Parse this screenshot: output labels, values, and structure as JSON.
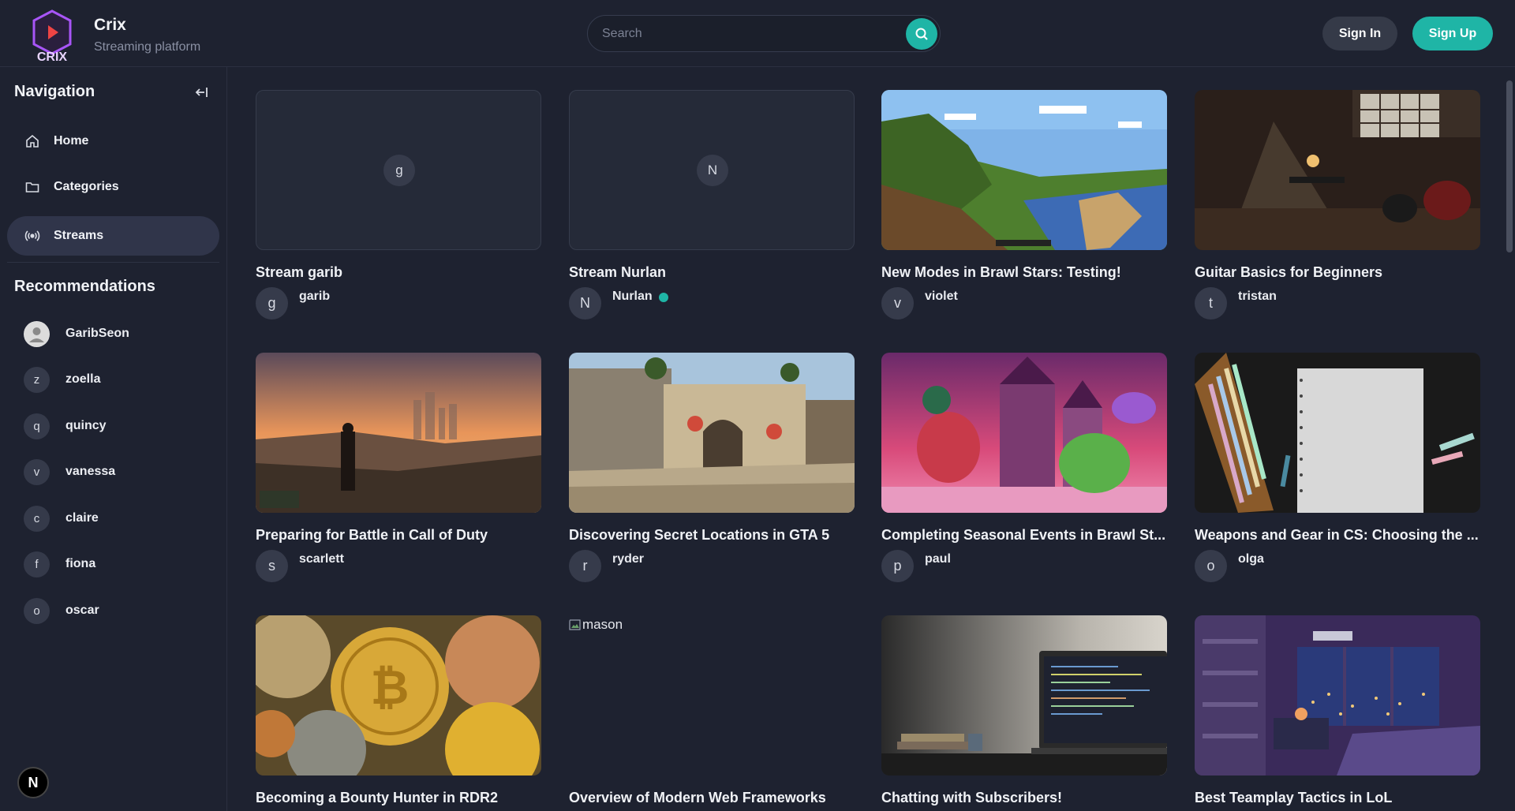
{
  "header": {
    "logo_text": "CRIX",
    "brand_name": "Crix",
    "brand_sub": "Streaming platform",
    "search_placeholder": "Search",
    "signin_label": "Sign In",
    "signup_label": "Sign Up"
  },
  "colors": {
    "accent": "#1fb5a6",
    "background": "#1e2230",
    "logo": "#a855f7"
  },
  "sidebar": {
    "nav_title": "Navigation",
    "nav_items": [
      {
        "label": "Home",
        "icon": "home-icon"
      },
      {
        "label": "Categories",
        "icon": "folder-icon"
      },
      {
        "label": "Streams",
        "icon": "broadcast-icon",
        "active": true
      }
    ],
    "rec_title": "Recommendations",
    "recommendations": [
      {
        "initial": "",
        "name": "GaribSeon"
      },
      {
        "initial": "z",
        "name": "zoella"
      },
      {
        "initial": "q",
        "name": "quincy"
      },
      {
        "initial": "v",
        "name": "vanessa"
      },
      {
        "initial": "c",
        "name": "claire"
      },
      {
        "initial": "f",
        "name": "fiona"
      },
      {
        "initial": "o",
        "name": "oscar"
      }
    ],
    "badge": "N"
  },
  "streams": [
    {
      "title": "Stream garib",
      "user": "garib",
      "initial": "g",
      "thumb": "empty",
      "thumb_initial": "g"
    },
    {
      "title": "Stream Nurlan",
      "user": "Nurlan",
      "initial": "N",
      "thumb": "empty",
      "thumb_initial": "N",
      "live": true
    },
    {
      "title": "New Modes in Brawl Stars: Testing!",
      "user": "violet",
      "initial": "v",
      "thumb": "minecraft"
    },
    {
      "title": "Guitar Basics for Beginners",
      "user": "tristan",
      "initial": "t",
      "thumb": "studio"
    },
    {
      "title": "Preparing for Battle in Call of Duty",
      "user": "scarlett",
      "initial": "s",
      "thumb": "sunset-city"
    },
    {
      "title": "Discovering Secret Locations in GTA 5",
      "user": "ryder",
      "initial": "r",
      "thumb": "cs-map"
    },
    {
      "title": "Completing Seasonal Events in Brawl St...",
      "user": "paul",
      "initial": "p",
      "thumb": "brawl"
    },
    {
      "title": "Weapons and Gear in CS: Choosing the ...",
      "user": "olga",
      "initial": "o",
      "thumb": "pastels"
    },
    {
      "title": "Becoming a Bounty Hunter in RDR2",
      "user": "",
      "initial": "",
      "thumb": "coins"
    },
    {
      "title": "Overview of Modern Web Frameworks",
      "user": "",
      "initial": "",
      "thumb": "broken",
      "alt": "mason"
    },
    {
      "title": "Chatting with Subscribers!",
      "user": "",
      "initial": "",
      "thumb": "laptop"
    },
    {
      "title": "Best Teamplay Tactics in LoL",
      "user": "",
      "initial": "",
      "thumb": "room"
    }
  ]
}
